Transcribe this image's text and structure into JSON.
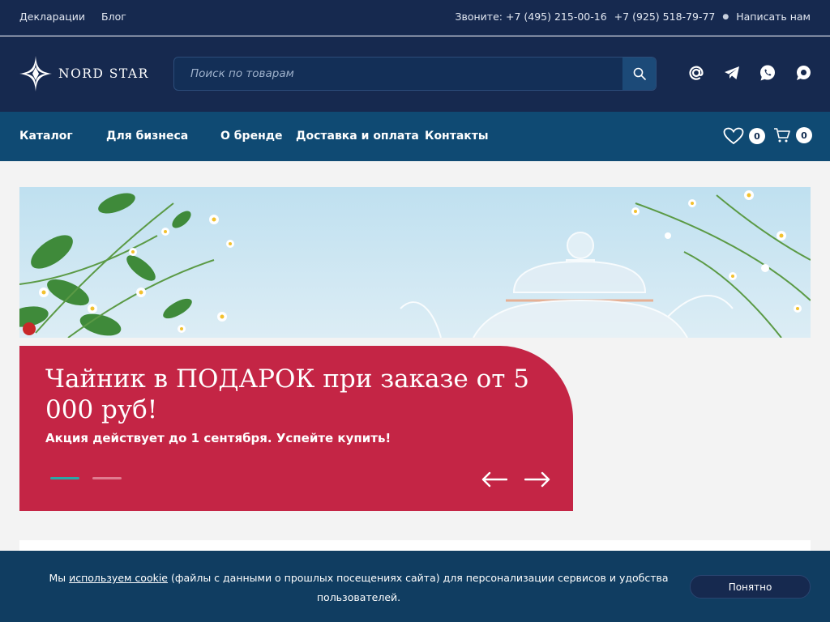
{
  "topbar": {
    "links": [
      "Декларации",
      "Блог"
    ],
    "call_label": "Звоните:",
    "phone1": "+7 (495) 215-00-16",
    "phone2": "+7 (925) 518-79-77",
    "write_label": "Написать нам"
  },
  "header": {
    "logo_text": "NORD STAR",
    "search_placeholder": "Поиск по товарам",
    "social_icons": [
      "email-icon",
      "telegram-icon",
      "whatsapp-icon",
      "chat-icon"
    ]
  },
  "nav": {
    "items": [
      "Каталог",
      "Для бизнеса",
      "О бренде",
      "Доставка и оплата",
      "Контакты"
    ],
    "favorites_count": "0",
    "cart_count": "0"
  },
  "promo": {
    "title": "Чайник в ПОДАРОК при заказе от 5 000 руб!",
    "subtitle": "Акция действует до 1 сентября. Успейте купить!",
    "slide_count": 2,
    "active_slide": 1
  },
  "cookie": {
    "text_before": "Мы",
    "link_text": "используем cookie",
    "text_after": "(файлы с данными о прошлых посещениях сайта) для персонализации сервисов и удобства пользователей.",
    "button_label": "Понятно"
  },
  "colors": {
    "header_bg": "#16294f",
    "nav_bg": "#0f4a73",
    "promo_bg": "#c42545",
    "accent_teal": "#2aa8a8",
    "cookie_bg": "#103d61"
  }
}
